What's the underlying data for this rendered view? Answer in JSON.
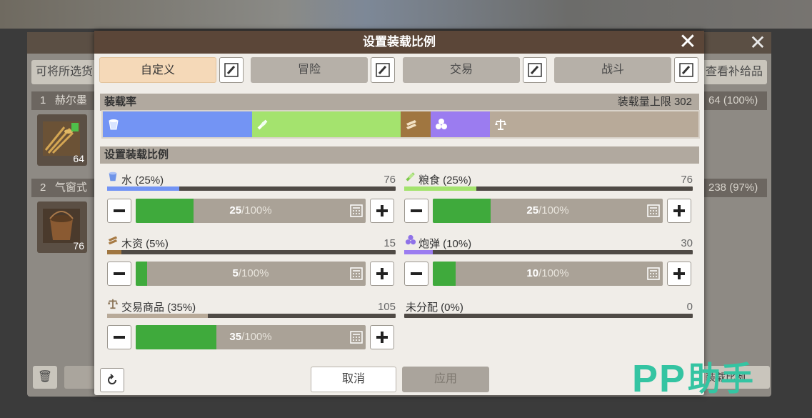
{
  "colors": {
    "water": "#7394f4",
    "food": "#a4e36e",
    "wood": "#a07640",
    "ammo": "#9b7cf0",
    "trade": "#b8aa99",
    "slider_fill": "#3faa3c",
    "title_bar": "#5b4638"
  },
  "background": {
    "filter_label": "可将所选货",
    "supply_label": "查看补给品",
    "row1": {
      "index": "1",
      "name": "赫尔墨",
      "stat": "64 (100%)",
      "count": "64"
    },
    "row2": {
      "index": "2",
      "name": "气窗式",
      "stat": "238 (97%)",
      "count": "76"
    },
    "fill_btn": "装载比例"
  },
  "dialog": {
    "title": "设置装载比例",
    "presets": [
      {
        "label": "自定义",
        "active": true
      },
      {
        "label": "冒险",
        "active": false
      },
      {
        "label": "交易",
        "active": false
      },
      {
        "label": "战斗",
        "active": false
      }
    ],
    "load_rate": {
      "label": "装载率",
      "capacity_label": "装载量上限 302",
      "segments": [
        {
          "id": "water",
          "percent": 25,
          "icon": "water-bucket-icon"
        },
        {
          "id": "food",
          "percent": 25,
          "icon": "food-grain-icon"
        },
        {
          "id": "wood",
          "percent": 5,
          "icon": "wood-planks-icon"
        },
        {
          "id": "ammo",
          "percent": 10,
          "icon": "cannonball-icon"
        },
        {
          "id": "trade",
          "percent": 35,
          "icon": "scales-icon"
        }
      ]
    },
    "ratio_section_label": "设置装载比例",
    "resources": {
      "water": {
        "name": "水 (25%)",
        "amount": "76",
        "percent": 25,
        "slider_value": "25",
        "slider_suffix": "/100%"
      },
      "food": {
        "name": "粮食 (25%)",
        "amount": "76",
        "percent": 25,
        "slider_value": "25",
        "slider_suffix": "/100%"
      },
      "wood": {
        "name": "木资 (5%)",
        "amount": "15",
        "percent": 5,
        "slider_value": "5",
        "slider_suffix": "/100%"
      },
      "ammo": {
        "name": "炮弹 (10%)",
        "amount": "30",
        "percent": 10,
        "slider_value": "10",
        "slider_suffix": "/100%"
      },
      "trade": {
        "name": "交易商品 (35%)",
        "amount": "105",
        "percent": 35,
        "slider_value": "35",
        "slider_suffix": "/100%"
      },
      "unallocated": {
        "name": "未分配 (0%)",
        "amount": "0",
        "percent": 0
      }
    },
    "cancel_label": "取消",
    "apply_label": "应用"
  },
  "watermark": {
    "latin": "PP",
    "cn": "助手"
  }
}
